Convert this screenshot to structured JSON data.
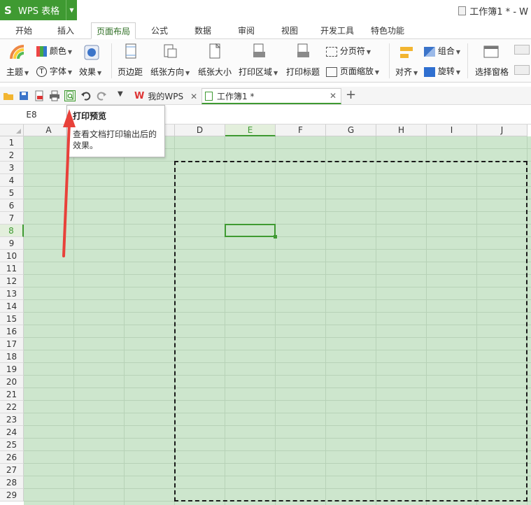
{
  "app": {
    "name": "WPS 表格",
    "logo": "S"
  },
  "window": {
    "doc_title": "工作簿1 * - W"
  },
  "ribbon_tabs": [
    {
      "label": "开始"
    },
    {
      "label": "插入"
    },
    {
      "label": "页面布局",
      "active": true
    },
    {
      "label": "公式"
    },
    {
      "label": "数据"
    },
    {
      "label": "审阅"
    },
    {
      "label": "视图"
    },
    {
      "label": "开发工具"
    },
    {
      "label": "特色功能"
    }
  ],
  "ribbon": {
    "theme": "主题",
    "colors": "颜色",
    "fonts": "字体",
    "effects": "效果",
    "margins": "页边距",
    "orientation": "纸张方向",
    "size": "纸张大小",
    "print_area": "打印区域",
    "print_titles": "打印标题",
    "page_break": "分页符",
    "page_zoom": "页面缩放",
    "align": "对齐",
    "group": "组合",
    "rotate": "旋转",
    "selection_pane": "选择窗格"
  },
  "doc_tabs": [
    {
      "label": "我的WPS"
    },
    {
      "label": "工作簿1 *",
      "active": true
    }
  ],
  "formula_bar": {
    "name_box": "E8"
  },
  "tooltip": {
    "title": "打印预览",
    "body": "查看文档打印输出后的效果。"
  },
  "columns": [
    "A",
    "B",
    "C",
    "D",
    "E",
    "F",
    "G",
    "H",
    "I",
    "J"
  ],
  "rows": [
    "1",
    "2",
    "3",
    "4",
    "5",
    "6",
    "7",
    "8",
    "9",
    "10",
    "11",
    "12",
    "13",
    "14",
    "15",
    "16",
    "17",
    "18",
    "19",
    "20",
    "21",
    "22",
    "23",
    "24",
    "25",
    "26",
    "27",
    "28",
    "29"
  ],
  "selected": {
    "column": "E",
    "row": "8"
  },
  "colors": {
    "accent": "#3f9a32",
    "cell_bg": "#cde6cd",
    "arrow": "#e8413a"
  }
}
